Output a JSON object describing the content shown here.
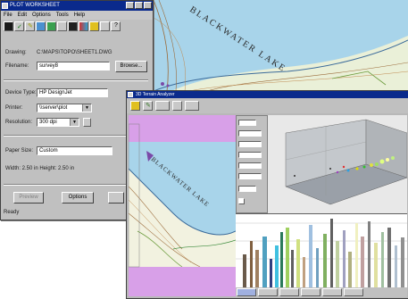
{
  "dialog": {
    "title": "PLOT WORKSHEET",
    "menu": [
      "File",
      "Edit",
      "Options",
      "Tools",
      "Help"
    ],
    "drawing_label": "Drawing:",
    "drawing_value": "C:\\MAPS\\TOPO\\SHEET1.DWG",
    "filename_label": "Filename:",
    "filename_value": "survey8",
    "browse_label": "Browse...",
    "device_type_label": "Device Type:",
    "device_type_value": "HP DesignJet",
    "printer_label": "Printer:",
    "printer_value": "\\\\server\\plot",
    "resolution_label": "Resolution:",
    "resolution_value": "300 dpi",
    "paper_size_label": "Paper Size:",
    "paper_size_value": "Custom",
    "dimensions": "Width: 2.50 in   Height: 2.50 in",
    "btn_left": "Preview",
    "btn_right": "Options",
    "status": "Ready"
  },
  "viewer": {
    "title": "3D Terrain Analyzer",
    "lake_label": "BLACKWATER LAKE"
  },
  "back_map": {
    "lake_label": "BLACKWATER LAKE"
  },
  "colors": {
    "titlebar": "#0a2a8c",
    "lake": "#a8d4ea",
    "panel": "#c0c0c0",
    "legend_purple": "#d8a0e8"
  }
}
